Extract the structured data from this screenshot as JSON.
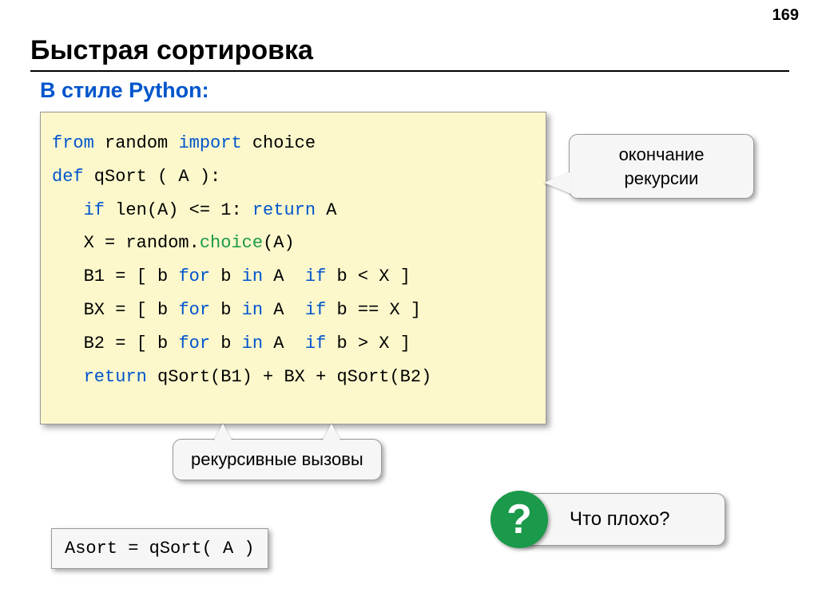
{
  "page_number": "169",
  "title": "Быстрая сортировка",
  "subtitle": "В стиле Python:",
  "code": {
    "line1_from": "from",
    "line1_random": " random ",
    "line1_import": "import",
    "line1_choice": " choice",
    "line2_def": "def",
    "line2_rest": " qSort ( A ):",
    "line3_indent": "   ",
    "line3_if": "if",
    "line3_mid": " len(A) <= 1: ",
    "line3_return": "return",
    "line3_end": " A",
    "line4": "   X = random.",
    "line4_choice": "choice",
    "line4_end": "(A)",
    "line5_a": "   B1 = [ b ",
    "line5_for": "for",
    "line5_b": " b ",
    "line5_in": "in",
    "line5_c": " A  ",
    "line5_if": "if",
    "line5_d": " b < X ]",
    "line6_a": "   BX = [ b ",
    "line6_for": "for",
    "line6_b": " b ",
    "line6_in": "in",
    "line6_c": " A  ",
    "line6_if": "if",
    "line6_d": " b == X ]",
    "line7_a": "   B2 = [ b ",
    "line7_for": "for",
    "line7_b": " b ",
    "line7_in": "in",
    "line7_c": " A  ",
    "line7_if": "if",
    "line7_d": " b > X ]",
    "line8_indent": "   ",
    "line8_return": "return",
    "line8_rest": " qSort(B1) + BX + qSort(B2)"
  },
  "callouts": {
    "recursion_end": "окончание рекурсии",
    "recursive_calls": "рекурсивные вызовы",
    "question": "Что плохо?",
    "qmark": "?"
  },
  "usage": "Asort = qSort( A )"
}
